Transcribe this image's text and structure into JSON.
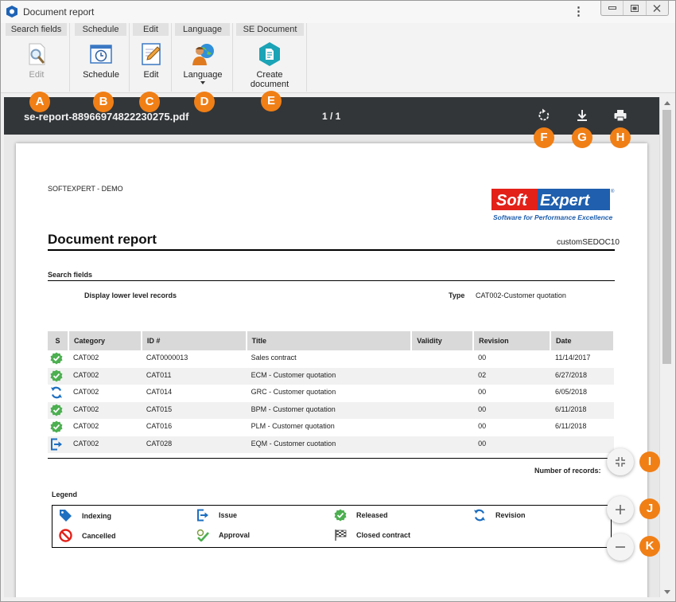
{
  "window": {
    "title": "Document report"
  },
  "ribbon": {
    "groups": [
      {
        "title": "Search fields",
        "button": "Edit"
      },
      {
        "title": "Schedule",
        "button": "Schedule"
      },
      {
        "title": "Edit",
        "button": "Edit"
      },
      {
        "title": "Language",
        "button": "Language"
      },
      {
        "title": "SE Document",
        "button": "Create document"
      }
    ]
  },
  "viewer": {
    "filename": "se-report-88966974822230275.pdf",
    "page_indicator": "1 / 1"
  },
  "report": {
    "company": "SOFTEXPERT - DEMO",
    "logo_name": "SoftExpert",
    "logo_tagline": "Software for Performance Excellence",
    "logo_reg": "®",
    "title": "Document report",
    "doc_id": "customSEDOC10",
    "search_fields": {
      "title": "Search fields",
      "lower_level": "Display lower level records",
      "type_label": "Type",
      "type_value": "CAT002-Customer quotation"
    },
    "columns": [
      "S",
      "Category",
      "ID #",
      "Title",
      "Validity",
      "Revision",
      "Date"
    ],
    "rows": [
      {
        "status": "released",
        "category": "CAT002",
        "id": "CAT0000013",
        "title": "Sales contract",
        "validity": "",
        "revision": "00",
        "date": "11/14/2017"
      },
      {
        "status": "released",
        "category": "CAT002",
        "id": "CAT011",
        "title": "ECM - Customer quotation",
        "validity": "",
        "revision": "02",
        "date": "6/27/2018"
      },
      {
        "status": "revision",
        "category": "CAT002",
        "id": "CAT014",
        "title": "GRC - Customer quotation",
        "validity": "",
        "revision": "00",
        "date": "6/05/2018"
      },
      {
        "status": "released",
        "category": "CAT002",
        "id": "CAT015",
        "title": "BPM - Customer quotation",
        "validity": "",
        "revision": "00",
        "date": "6/11/2018"
      },
      {
        "status": "released",
        "category": "CAT002",
        "id": "CAT016",
        "title": "PLM - Customer quotation",
        "validity": "",
        "revision": "00",
        "date": "6/11/2018"
      },
      {
        "status": "issue",
        "category": "CAT002",
        "id": "CAT028",
        "title": "EQM - Customer cuotation",
        "validity": "",
        "revision": "00",
        "date": ""
      }
    ],
    "records_label": "Number of records:",
    "legend": {
      "title": "Legend",
      "items": [
        "Indexing",
        "Issue",
        "Released",
        "Revision",
        "Cancelled",
        "Approval",
        "Closed contract"
      ]
    }
  },
  "callouts": [
    "A",
    "B",
    "C",
    "D",
    "E",
    "F",
    "G",
    "H",
    "I",
    "J",
    "K"
  ],
  "colors": {
    "callout": "#f07f16",
    "toolbar": "#323639",
    "released": "#4caf50",
    "revision": "#1e6fc0",
    "logo_red": "#e32119",
    "logo_blue": "#1f5fae"
  },
  "icons": [
    "app-icon",
    "kebab-menu-icon",
    "minimize-icon",
    "restore-icon",
    "close-icon",
    "magnifier-icon",
    "clock-icon",
    "pencil-icon",
    "person-globe-icon",
    "create-document-icon",
    "rotate-icon",
    "download-icon",
    "print-icon",
    "collapse-icon",
    "zoom-in-icon",
    "zoom-out-icon"
  ]
}
